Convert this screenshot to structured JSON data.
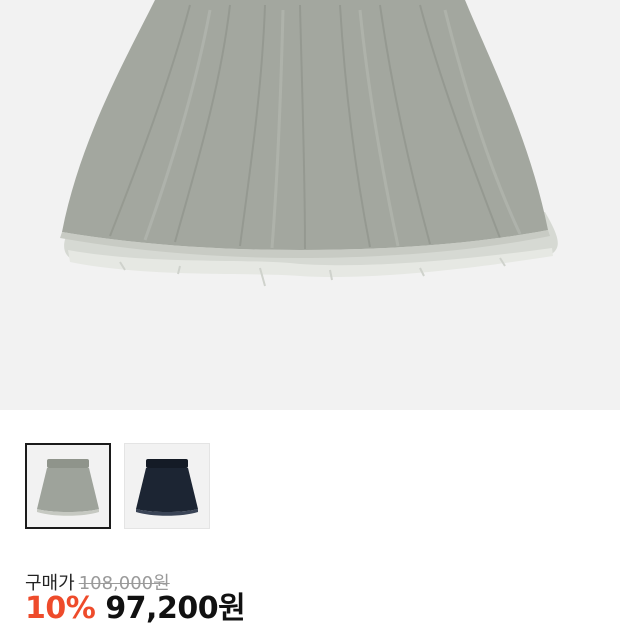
{
  "product": {
    "image_alt": "grey tulle mini skirt",
    "thumbnails": [
      {
        "name": "grey",
        "color": "#9ea39b",
        "selected": true
      },
      {
        "name": "navy",
        "color": "#1c2533",
        "selected": false
      }
    ]
  },
  "price": {
    "label": "구매가",
    "original": "108,000원",
    "discount": "10%",
    "sale": "97,200원",
    "discount_color": "#ee4b2b"
  }
}
